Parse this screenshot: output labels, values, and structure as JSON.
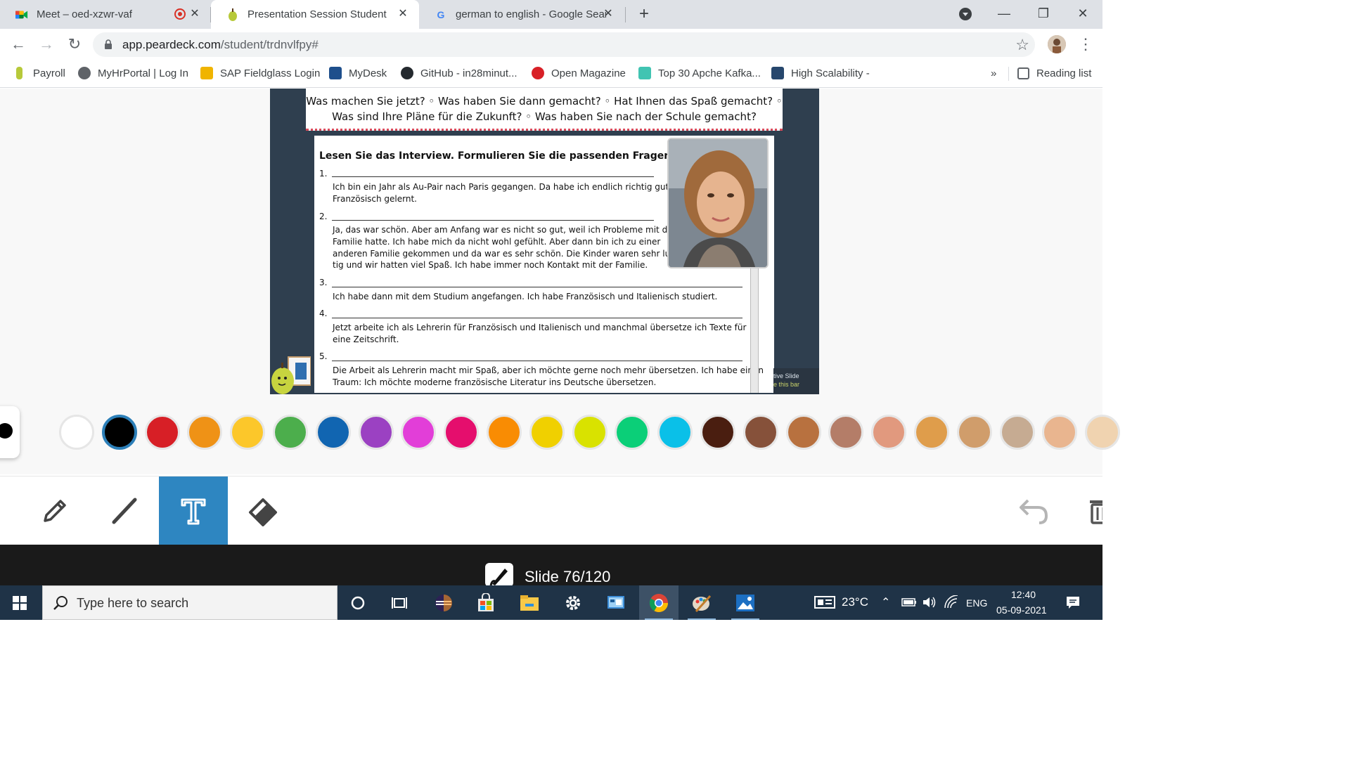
{
  "browser": {
    "tabs": [
      {
        "title": "Meet – oed-xzwr-vaf",
        "favicon": "google-meet-icon",
        "recording": true
      },
      {
        "title": "Presentation Session Student",
        "favicon": "peardeck-pear-icon",
        "active": true
      },
      {
        "title": "german to english - Google Sear",
        "favicon": "google-g-icon"
      }
    ],
    "new_tab": "+",
    "address": {
      "host": "app.peardeck.com",
      "path": "/student/trdnvlfpy#"
    },
    "bookmarks": [
      {
        "label": "Payroll",
        "icon": "payroll-icon"
      },
      {
        "label": "MyHrPortal | Log In",
        "icon": "globe-icon"
      },
      {
        "label": "SAP Fieldglass Login",
        "icon": "sap-fieldglass-icon"
      },
      {
        "label": "MyDesk",
        "icon": "mydesk-icon"
      },
      {
        "label": "GitHub - in28minut...",
        "icon": "github-icon"
      },
      {
        "label": "Open Magazine",
        "icon": "open-magazine-icon"
      },
      {
        "label": "Top 30 Apche Kafka...",
        "icon": "kafka-icon"
      },
      {
        "label": "High Scalability -",
        "icon": "high-scalability-icon"
      }
    ],
    "overflow": "»",
    "reading_list": "Reading list"
  },
  "slide": {
    "question_banner": {
      "line1": "Was machen Sie jetzt? ◦ Was haben Sie dann gemacht? ◦ Hat Ihnen das Spaß gemacht? ◦",
      "line2": "Was sind Ihre Pläne für die Zukunft? ◦ Was haben Sie nach der Schule gemacht?"
    },
    "worksheet_title": "Lesen Sie das Interview. Formulieren Sie die passenden Fragen.",
    "items": [
      {
        "num": "1.",
        "lines": [
          "Ich bin ein Jahr als Au-Pair nach Paris gegangen. Da habe ich endlich richtig gut",
          "Französisch gelernt."
        ]
      },
      {
        "num": "2.",
        "lines": [
          "Ja, das war schön. Aber am Anfang war es nicht so gut, weil ich Probleme mit der",
          "Familie hatte. Ich habe mich da nicht wohl gefühlt. Aber dann bin ich zu einer",
          "anderen Familie gekommen und da war es sehr schön. Die Kinder waren sehr lus-",
          "tig und wir hatten viel Spaß. Ich habe immer noch Kontakt mit der Familie."
        ]
      },
      {
        "num": "3.",
        "lines": [
          "Ich habe dann mit dem Studium angefangen. Ich habe Französisch und Italienisch studiert."
        ]
      },
      {
        "num": "4.",
        "lines": [
          "Jetzt arbeite ich als Lehrerin für Französisch und Italienisch und manchmal übersetze ich Texte für",
          "eine Zeitschrift."
        ]
      },
      {
        "num": "5.",
        "lines": [
          "Die Arbeit als Lehrerin macht mir Spaß, aber ich möchte gerne noch mehr übersetzen. Ich habe einen",
          "Traum: Ich möchte moderne französische Literatur ins Deutsche übersetzen."
        ]
      }
    ],
    "strip_line1": "tive Slide",
    "strip_line2": "e this bar"
  },
  "palette": {
    "colors": [
      "#ffffff",
      "#000000",
      "#d71f26",
      "#ef9216",
      "#fcc72a",
      "#4cae4c",
      "#1165b1",
      "#9b41c2",
      "#e23ed8",
      "#e50e6d",
      "#f98c03",
      "#f0d000",
      "#d9e200",
      "#0bcf78",
      "#0ac0e8",
      "#4a1e10",
      "#86513a",
      "#b8713f",
      "#b47d68",
      "#e1997e",
      "#df9d4b",
      "#d09d6b",
      "#c6ab92",
      "#e9b58f",
      "#f0d3b0"
    ],
    "selected_index": 1
  },
  "tools": [
    {
      "name": "pen",
      "icon": "pen-icon"
    },
    {
      "name": "line",
      "icon": "line-icon"
    },
    {
      "name": "text",
      "icon": "text-tool-icon",
      "active": true
    },
    {
      "name": "eraser",
      "icon": "eraser-icon"
    }
  ],
  "slide_counter": "Slide 76/120",
  "taskbar": {
    "search_placeholder": "Type here to search",
    "weather": "23°C",
    "language": "ENG",
    "time": "12:40",
    "date": "05-09-2021"
  }
}
